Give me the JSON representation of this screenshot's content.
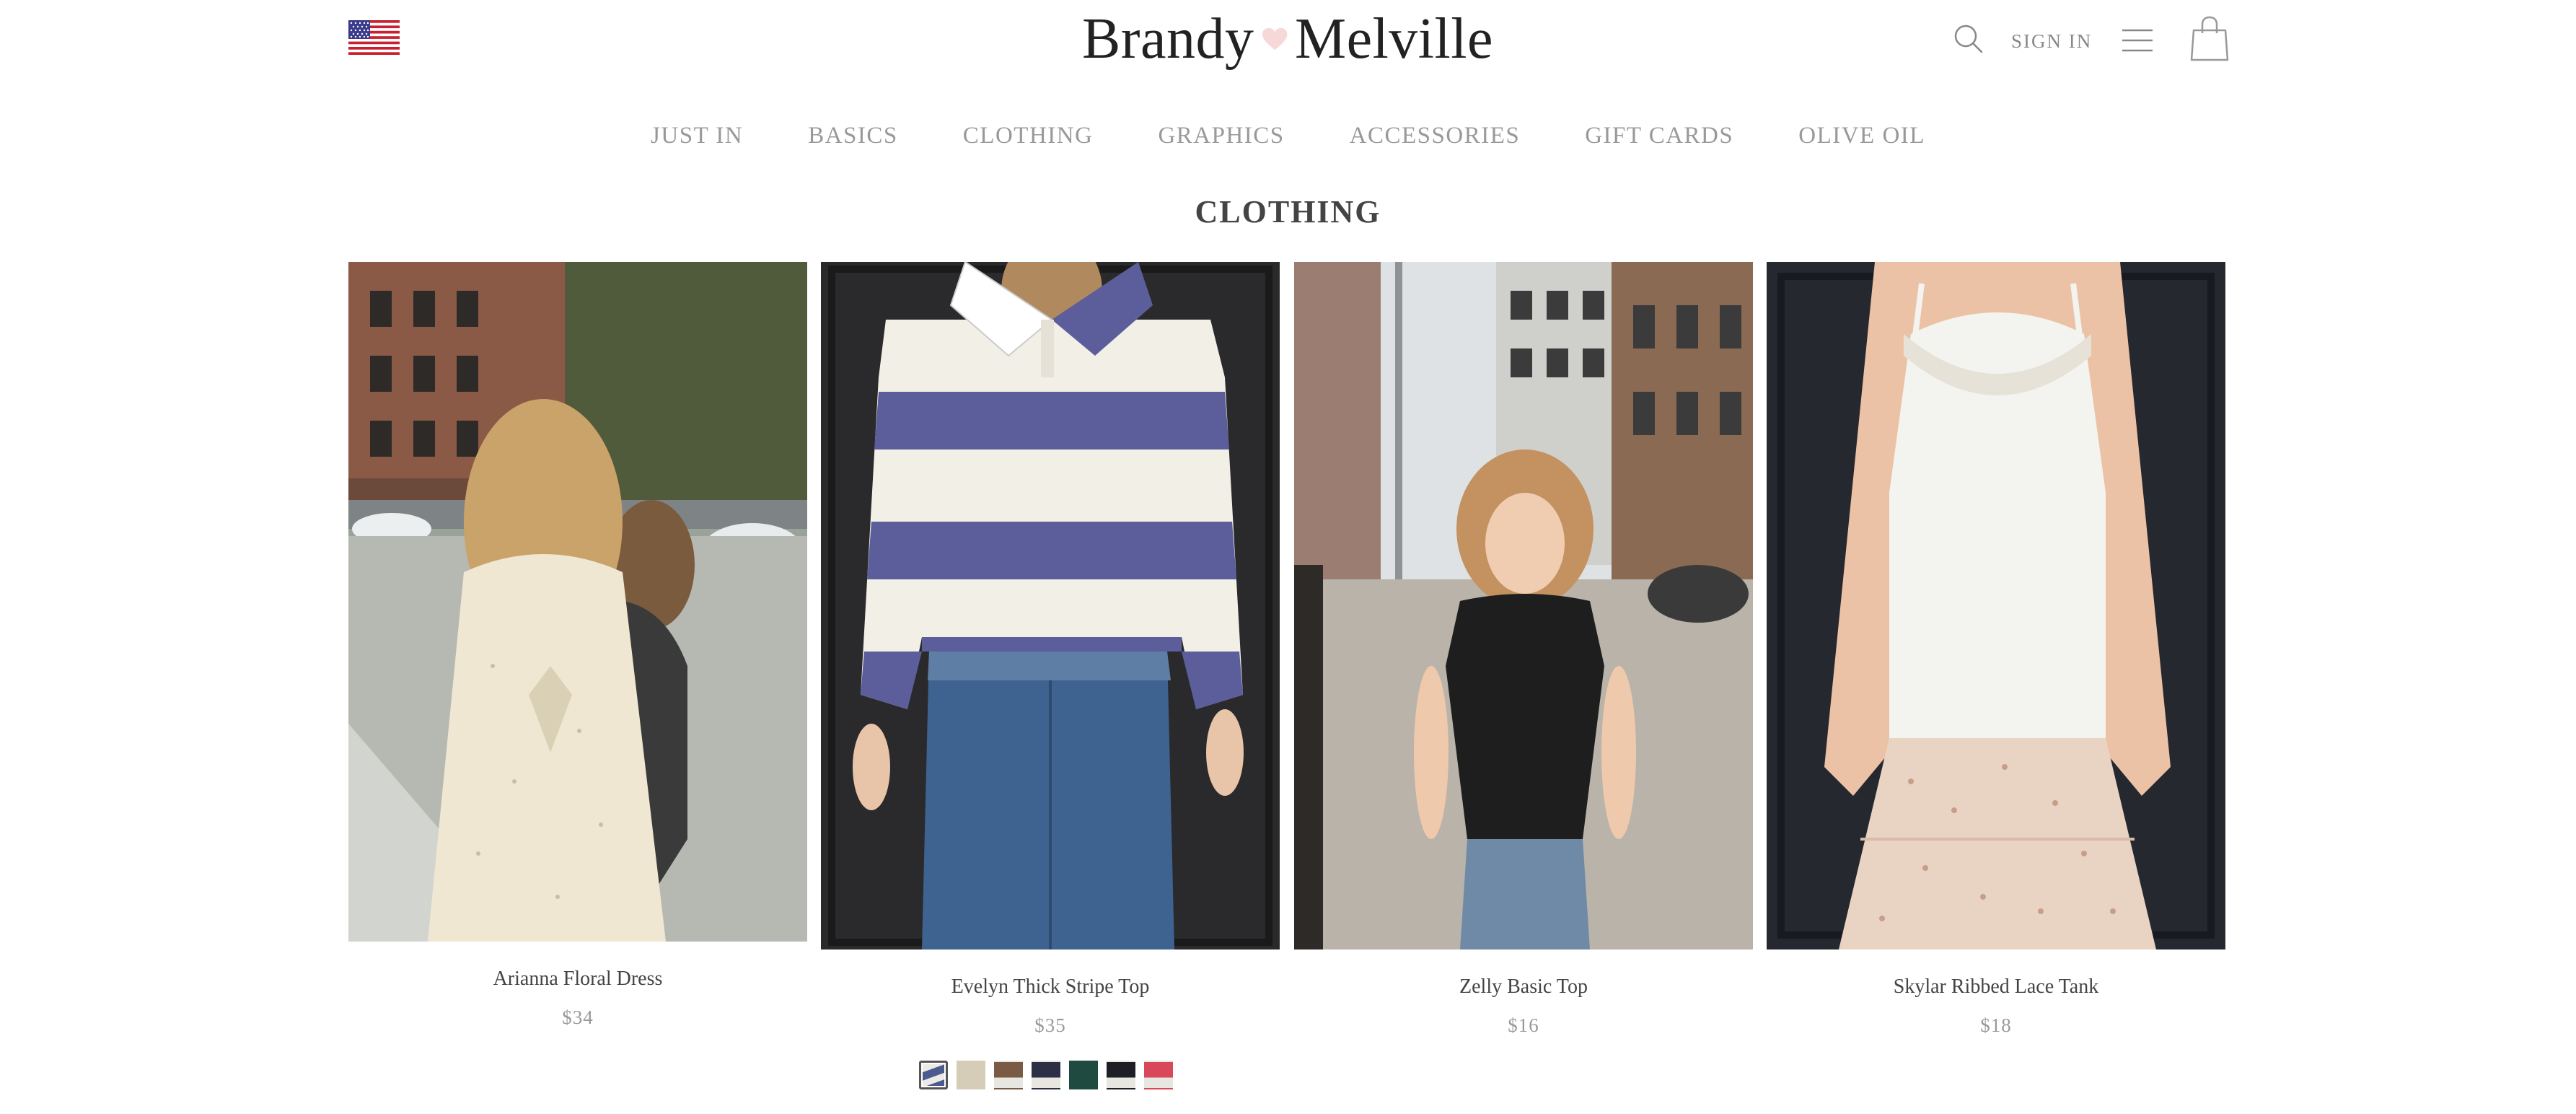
{
  "header": {
    "logo_left": "Brandy",
    "logo_right": "Melville",
    "sign_in_label": "SIGN IN",
    "flag_icon": "us-flag-icon",
    "search_icon": "search-icon",
    "menu_icon": "hamburger-menu-icon",
    "bag_icon": "shopping-bag-icon"
  },
  "nav": {
    "items": [
      {
        "label": "JUST IN"
      },
      {
        "label": "BASICS"
      },
      {
        "label": "CLOTHING"
      },
      {
        "label": "GRAPHICS"
      },
      {
        "label": "ACCESSORIES"
      },
      {
        "label": "GIFT CARDS"
      },
      {
        "label": "OLIVE OIL"
      }
    ]
  },
  "page": {
    "title": "CLOTHING"
  },
  "products": [
    {
      "name": "Arianna Floral Dress",
      "price": "$34"
    },
    {
      "name": "Evelyn Thick Stripe Top",
      "price": "$35"
    },
    {
      "name": "Zelly Basic Top",
      "price": "$16"
    },
    {
      "name": "Skylar Ribbed Lace Tank",
      "price": "$18"
    }
  ],
  "swatches": {
    "selected_index": 0,
    "colors": [
      "#4d5a8f",
      "#d6cdb8",
      "#7a5a45",
      "#2c2f45",
      "#1f4a40",
      "#1e1e26",
      "#d9485a"
    ]
  },
  "colors": {
    "heart": "#f6d8d8",
    "nav_text": "#999999",
    "background": "#ffffff"
  }
}
